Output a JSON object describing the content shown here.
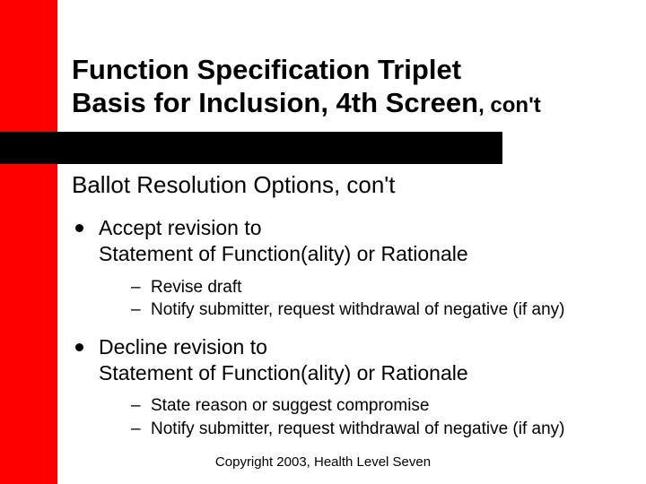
{
  "title_line1": "Function Specification Triplet",
  "title_line2_main": "Basis for Inclusion, 4th Screen",
  "title_line2_suffix": ", con't",
  "subheading": "Ballot Resolution Options, con't",
  "bullets": [
    {
      "text_line1": "Accept revision to",
      "text_line2": "Statement of Function(ality) or Rationale",
      "sub": [
        "Revise draft",
        "Notify submitter, request withdrawal of negative (if any)"
      ]
    },
    {
      "text_line1": "Decline revision to",
      "text_line2": "Statement of Function(ality) or Rationale",
      "sub": [
        "State reason or suggest compromise",
        "Notify submitter, request withdrawal of negative (if any)"
      ]
    }
  ],
  "footer": "Copyright 2003, Health Level Seven"
}
